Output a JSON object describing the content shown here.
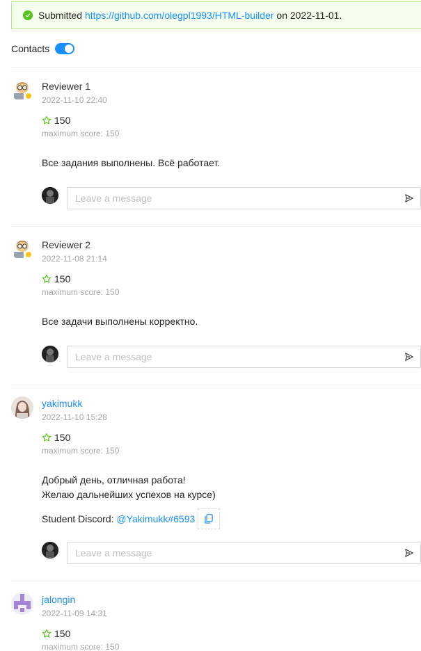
{
  "submission": {
    "prefix": "Submitted",
    "url": "https://github.com/olegpl1993/HTML-builder",
    "on_label": "on",
    "date": "2022-11-01."
  },
  "contacts": {
    "label": "Contacts",
    "enabled": true
  },
  "message_placeholder": "Leave a message",
  "colors": {
    "accent": "#1890ff",
    "success": "#52c41a",
    "muted": "#a6a6a6"
  },
  "reviews": [
    {
      "author": "Reviewer 1",
      "date": "2022-11-10 22:40",
      "score": "150",
      "max_score": "maximum score: 150",
      "comment": "Все задания выполнены. Всё работает."
    },
    {
      "author": "Reviewer 2",
      "date": "2022-11-08 21:14",
      "score": "150",
      "max_score": "maximum score: 150",
      "comment": "Все задачи выполнены корректно."
    },
    {
      "author": "yakimukk",
      "date": "2022-11-10 15:28",
      "score": "150",
      "max_score": "maximum score: 150",
      "comment_lines": [
        "Добрый день, отличная работа!",
        "Желаю дальнейших успехов на курсе)"
      ],
      "discord_label": "Student Discord:",
      "discord_handle": "@Yakimukk#6593"
    },
    {
      "author": "jalongin",
      "date": "2022-11-09 14:31",
      "score": "150",
      "max_score": "maximum score: 150"
    }
  ]
}
